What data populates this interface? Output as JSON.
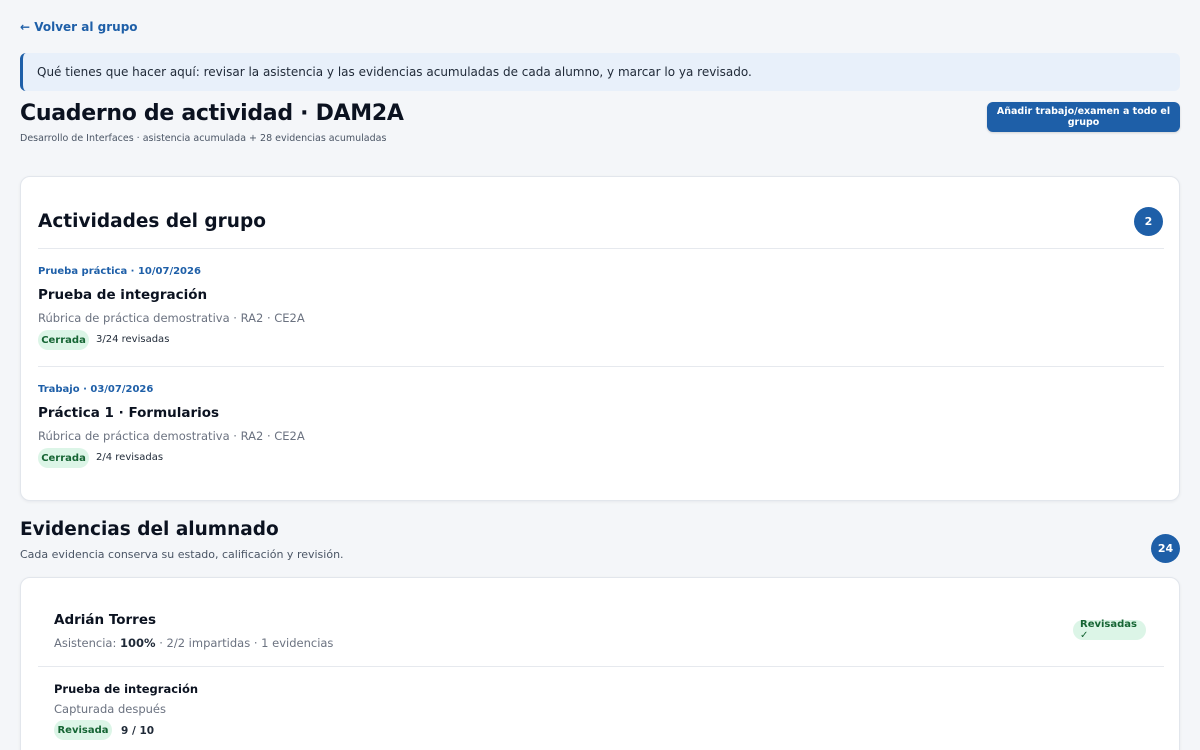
{
  "back_link": "← Volver al grupo",
  "info_banner": "Qué tienes que hacer aquí: revisar la asistencia y las evidencias acumuladas de cada alumno, y marcar lo ya revisado.",
  "header": {
    "title": "Cuaderno de actividad · DAM2A",
    "subtitle": "Desarrollo de Interfaces · asistencia acumulada + 28 evidencias acumuladas",
    "add_button": "Añadir trabajo/examen a todo el grupo"
  },
  "activities": {
    "title": "Actividades del grupo",
    "count": "2",
    "items": [
      {
        "meta": "Prueba práctica · 10/07/2026",
        "title": "Prueba de integración",
        "description": "Rúbrica de práctica demostrativa · RA2 · CE2A",
        "status": "Cerrada",
        "reviewed": "3/24 revisadas"
      },
      {
        "meta": "Trabajo · 03/07/2026",
        "title": "Práctica 1 · Formularios",
        "description": "Rúbrica de práctica demostrativa · RA2 · CE2A",
        "status": "Cerrada",
        "reviewed": "2/4 revisadas"
      }
    ]
  },
  "evidences": {
    "title": "Evidencias del alumnado",
    "subtitle": "Cada evidencia conserva su estado, calificación y revisión.",
    "count": "24",
    "students": [
      {
        "name": "Adrián Torres",
        "attendance_label": "Asistencia:",
        "attendance_value": "100%",
        "attendance_rest": "· 2/2 impartidas · 1 evidencias",
        "status": "Revisadas ✓",
        "evidences": [
          {
            "title": "Prueba de integración",
            "note": "Capturada después",
            "status": "Revisada",
            "grade": "9 / 10"
          }
        ]
      }
    ]
  },
  "colors": {
    "accent": "#1e5fa8",
    "banner_bg": "#e8f0fa",
    "success_bg": "#dcf5e7",
    "success_text": "#166534"
  }
}
